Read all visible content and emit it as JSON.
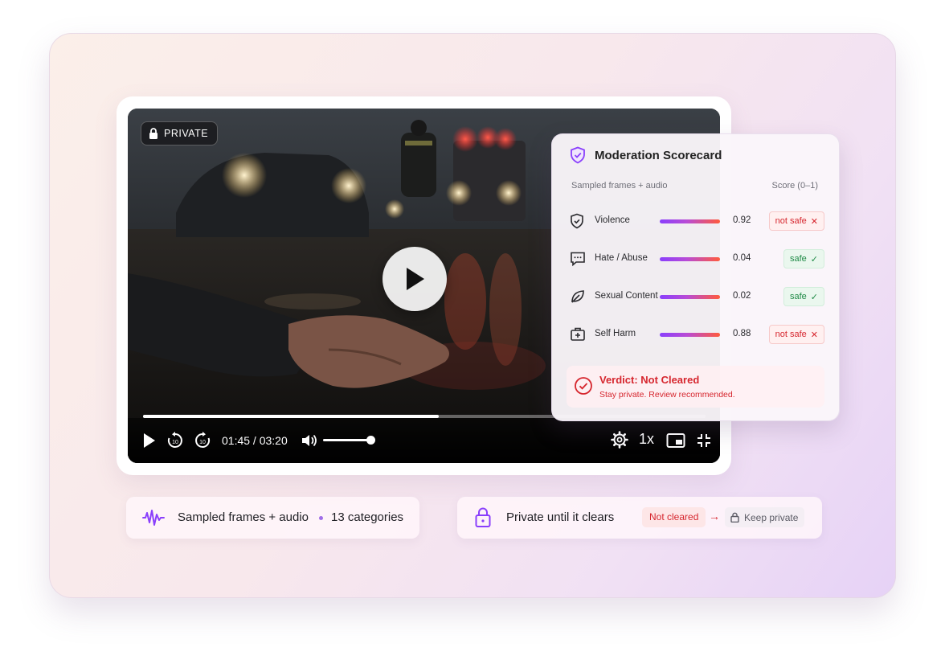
{
  "video": {
    "badge": "PRIVATE",
    "time": "01:45 / 03:20",
    "speed": "1x",
    "progress_fraction": 0.525,
    "volume_fraction": 1.0
  },
  "scorecard": {
    "title": "Moderation Scorecard",
    "sampled_label": "Sampled frames + audio",
    "score_label": "Score (0–1)",
    "rows": [
      {
        "label": "Violence",
        "score": "0.92",
        "status": "not safe",
        "status_type": "bad",
        "icon": "shield-icon"
      },
      {
        "label": "Hate / Abuse",
        "score": "0.04",
        "status": "safe",
        "status_type": "good",
        "icon": "chat-icon"
      },
      {
        "label": "Sexual Content",
        "score": "0.02",
        "status": "safe",
        "status_type": "good",
        "icon": "leaf-icon"
      },
      {
        "label": "Self Harm",
        "score": "0.88",
        "status": "not safe",
        "status_type": "bad",
        "icon": "medkit-icon"
      }
    ],
    "verdict_title": "Verdict: Not Cleared",
    "verdict_sub": "Stay private. Review recommended."
  },
  "chips": {
    "left_a": "Sampled frames + audio",
    "left_b": "13 categories",
    "right_title": "Private until it clears",
    "not_cleared": "Not cleared",
    "keep_private": "Keep private"
  },
  "colors": {
    "accent": "#8a3ffc",
    "danger": "#d6262e",
    "success": "#1f8a46"
  }
}
